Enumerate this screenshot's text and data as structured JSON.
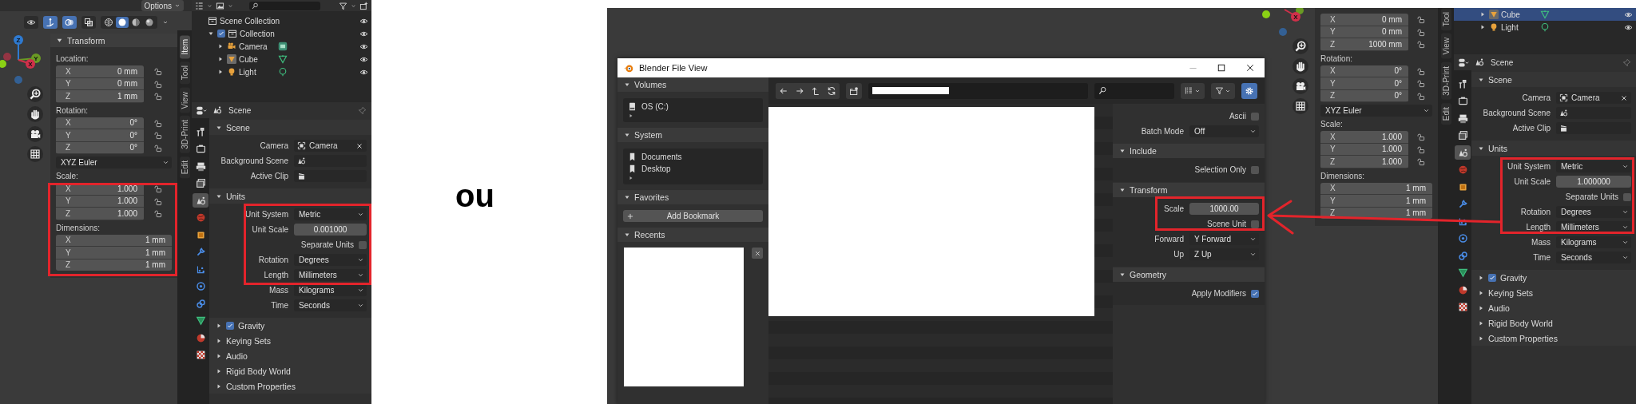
{
  "left_shot": {
    "viewport": {
      "options_label": "Options",
      "toggles": [
        {
          "kind": "visibility",
          "on": false
        },
        {
          "kind": "gizmo",
          "on": true
        },
        {
          "kind": "overlay",
          "on": true
        },
        {
          "kind": "xray",
          "on": false
        }
      ],
      "shading_modes": [
        {
          "kind": "wireframe",
          "selected": false
        },
        {
          "kind": "solid",
          "selected": true
        },
        {
          "kind": "material",
          "selected": false
        },
        {
          "kind": "rendered",
          "selected": false
        }
      ],
      "gizmo_labels": [
        "Z",
        "Y",
        "X"
      ]
    },
    "n_panel": {
      "title": "Transform",
      "groups": [
        {
          "label": "Location:",
          "kind": "lockable",
          "rows": [
            {
              "axis": "X",
              "value": "0 mm"
            },
            {
              "axis": "Y",
              "value": "0 mm"
            },
            {
              "axis": "Z",
              "value": "1 mm"
            }
          ]
        },
        {
          "label": "Rotation:",
          "kind": "lockable",
          "rows": [
            {
              "axis": "X",
              "value": "0°"
            },
            {
              "axis": "Y",
              "value": "0°"
            },
            {
              "axis": "Z",
              "value": "0°"
            }
          ]
        },
        {
          "kind": "mode",
          "value": "XYZ Euler"
        },
        {
          "label": "Scale:",
          "kind": "lockable",
          "rows": [
            {
              "axis": "X",
              "value": "1.000"
            },
            {
              "axis": "Y",
              "value": "1.000"
            },
            {
              "axis": "Z",
              "value": "1.000"
            }
          ]
        },
        {
          "label": "Dimensions:",
          "kind": "plain",
          "rows": [
            {
              "axis": "X",
              "value": "1 mm"
            },
            {
              "axis": "Y",
              "value": "1 mm"
            },
            {
              "axis": "Z",
              "value": "1 mm"
            }
          ]
        }
      ]
    },
    "n_tabs": [
      {
        "label": "Item",
        "selected": true
      },
      {
        "label": "Tool",
        "selected": false
      },
      {
        "label": "View",
        "selected": false
      },
      {
        "label": "3D-Print",
        "selected": false
      },
      {
        "label": "Edit",
        "selected": false
      }
    ],
    "outliner": {
      "items": [
        {
          "label": "Scene Collection",
          "kind": "collection",
          "selected": false,
          "children": [
            {
              "label": "Collection",
              "kind": "collection",
              "checked": true,
              "expanded": true,
              "selected": false,
              "children": [
                {
                  "label": "Camera",
                  "kind": "camera",
                  "expanded": false,
                  "selected": false
                },
                {
                  "label": "Cube",
                  "kind": "mesh",
                  "expanded": false,
                  "selected": false
                },
                {
                  "label": "Light",
                  "kind": "light",
                  "expanded": false,
                  "selected": false
                }
              ]
            }
          ]
        }
      ]
    },
    "properties": {
      "context": "Scene",
      "tabs": [
        {
          "kind": "tool",
          "selected": false
        },
        {
          "kind": "render",
          "selected": false
        },
        {
          "kind": "output",
          "selected": false
        },
        {
          "kind": "view_layer",
          "selected": false
        },
        {
          "kind": "scene",
          "selected": true
        },
        {
          "kind": "world",
          "selected": false
        },
        {
          "kind": "object",
          "selected": false
        },
        {
          "kind": "modifier",
          "selected": false
        },
        {
          "kind": "particles",
          "selected": false
        },
        {
          "kind": "physics",
          "selected": false
        },
        {
          "kind": "constraint",
          "selected": false
        },
        {
          "kind": "data",
          "selected": false
        },
        {
          "kind": "material",
          "selected": false
        },
        {
          "kind": "texture",
          "selected": false
        }
      ],
      "sections": [
        {
          "title": "Scene",
          "expanded": true,
          "rows": [
            {
              "kind": "object",
              "label": "Camera",
              "value": "Camera"
            },
            {
              "kind": "object",
              "label": "Background Scene"
            },
            {
              "kind": "object",
              "label": "Active Clip"
            }
          ]
        },
        {
          "title": "Units",
          "expanded": true,
          "rows": [
            {
              "kind": "dropdown",
              "label": "Unit System",
              "value": "Metric"
            },
            {
              "kind": "number",
              "label": "Unit Scale",
              "value": "0.001000"
            },
            {
              "kind": "checkbox",
              "label": "Separate Units",
              "checked": false
            },
            {
              "kind": "dropdown",
              "label": "Rotation",
              "value": "Degrees"
            },
            {
              "kind": "dropdown",
              "label": "Length",
              "value": "Millimeters"
            },
            {
              "kind": "dropdown",
              "label": "Mass",
              "value": "Kilograms"
            },
            {
              "kind": "dropdown",
              "label": "Time",
              "value": "Seconds"
            }
          ]
        },
        {
          "title": "Gravity",
          "expanded": false,
          "checked": true
        },
        {
          "title": "Keying Sets",
          "expanded": false
        },
        {
          "title": "Audio",
          "expanded": false
        },
        {
          "title": "Rigid Body World",
          "expanded": false
        },
        {
          "title": "Custom Properties",
          "expanded": false
        }
      ]
    }
  },
  "divider_text": "ou",
  "right_shot": {
    "viewport": {
      "gizmo_labels": [
        "X"
      ]
    },
    "n_panel": {
      "groups": [
        {
          "kind": "lockable",
          "rows": [
            {
              "axis": "X",
              "value": "0 mm"
            },
            {
              "axis": "Y",
              "value": "0 mm"
            },
            {
              "axis": "Z",
              "value": "1000 mm"
            }
          ]
        },
        {
          "label": "Rotation:",
          "kind": "lockable",
          "rows": [
            {
              "axis": "X",
              "value": "0°"
            },
            {
              "axis": "Y",
              "value": "0°"
            },
            {
              "axis": "Z",
              "value": "0°"
            }
          ]
        },
        {
          "kind": "mode",
          "value": "XYZ Euler"
        },
        {
          "label": "Scale:",
          "kind": "lockable",
          "rows": [
            {
              "axis": "X",
              "value": "1.000"
            },
            {
              "axis": "Y",
              "value": "1.000"
            },
            {
              "axis": "Z",
              "value": "1.000"
            }
          ]
        },
        {
          "label": "Dimensions:",
          "kind": "plain",
          "rows": [
            {
              "axis": "X",
              "value": "1 mm"
            },
            {
              "axis": "Y",
              "value": "1 mm"
            },
            {
              "axis": "Z",
              "value": "1 mm"
            }
          ]
        }
      ]
    },
    "n_tabs": [
      {
        "label": "Tool",
        "selected": false
      },
      {
        "label": "View",
        "selected": false
      },
      {
        "label": "3D-Print",
        "selected": false
      },
      {
        "label": "Edit",
        "selected": false
      }
    ],
    "file_browser": {
      "title": "Blender File View",
      "options_toggle": {
        "on": true
      },
      "sidebar": [
        {
          "title": "Volumes",
          "expanded": true,
          "kind": "list",
          "items": [
            {
              "label": "OS (C:)",
              "kind": "drive"
            }
          ]
        },
        {
          "title": "System",
          "expanded": true,
          "kind": "list",
          "items": [
            {
              "label": "Documents",
              "kind": "bookmark"
            },
            {
              "label": "Desktop",
              "kind": "bookmark"
            }
          ]
        },
        {
          "title": "Favorites",
          "expanded": true,
          "kind": "button",
          "button": "Add Bookmark"
        },
        {
          "title": "Recents",
          "expanded": true,
          "kind": "recent"
        }
      ],
      "options": {
        "rows": [
          {
            "kind": "checkbox",
            "label": "Ascii",
            "checked": false
          },
          {
            "kind": "dropdown",
            "label": "Batch Mode",
            "value": "Off"
          }
        ],
        "sections": [
          {
            "title": "Include",
            "expanded": true,
            "rows": [
              {
                "kind": "checkbox",
                "label": "Selection Only",
                "checked": false
              }
            ]
          },
          {
            "title": "Transform",
            "expanded": true,
            "rows": [
              {
                "kind": "number",
                "label": "Scale",
                "value": "1000.00"
              },
              {
                "kind": "checkbox",
                "label": "Scene Unit",
                "checked": false
              },
              {
                "kind": "dropdown",
                "label": "Forward",
                "value": "Y Forward"
              },
              {
                "kind": "dropdown",
                "label": "Up",
                "value": "Z Up"
              }
            ]
          },
          {
            "title": "Geometry",
            "expanded": true,
            "rows": [
              {
                "kind": "checkbox",
                "label": "Apply Modifiers",
                "checked": true
              }
            ]
          }
        ]
      }
    },
    "outliner": {
      "items": [
        {
          "label": "Cube",
          "kind": "mesh",
          "expanded": false,
          "selected": true
        },
        {
          "label": "Light",
          "kind": "light",
          "expanded": false,
          "selected": false
        }
      ]
    },
    "properties": {
      "context": "Scene",
      "tabs": [
        {
          "kind": "tool",
          "selected": false
        },
        {
          "kind": "render",
          "selected": false
        },
        {
          "kind": "output",
          "selected": false
        },
        {
          "kind": "view_layer",
          "selected": false
        },
        {
          "kind": "scene",
          "selected": true
        },
        {
          "kind": "world",
          "selected": false
        },
        {
          "kind": "object",
          "selected": false
        },
        {
          "kind": "modifier",
          "selected": false
        },
        {
          "kind": "particles",
          "selected": false
        },
        {
          "kind": "physics",
          "selected": false
        },
        {
          "kind": "constraint",
          "selected": false
        },
        {
          "kind": "data",
          "selected": false
        },
        {
          "kind": "material",
          "selected": false
        },
        {
          "kind": "texture",
          "selected": false
        }
      ],
      "sections": [
        {
          "title": "Scene",
          "expanded": true,
          "rows": [
            {
              "kind": "object",
              "label": "Camera",
              "value": "Camera"
            },
            {
              "kind": "object",
              "label": "Background Scene"
            },
            {
              "kind": "object",
              "label": "Active Clip"
            }
          ]
        },
        {
          "title": "Units",
          "expanded": true,
          "rows": [
            {
              "kind": "dropdown",
              "label": "Unit System",
              "value": "Metric"
            },
            {
              "kind": "number",
              "label": "Unit Scale",
              "value": "1.000000"
            },
            {
              "kind": "checkbox",
              "label": "Separate Units",
              "checked": false
            },
            {
              "kind": "dropdown",
              "label": "Rotation",
              "value": "Degrees"
            },
            {
              "kind": "dropdown",
              "label": "Length",
              "value": "Millimeters"
            },
            {
              "kind": "dropdown",
              "label": "Mass",
              "value": "Kilograms"
            },
            {
              "kind": "dropdown",
              "label": "Time",
              "value": "Seconds"
            }
          ]
        },
        {
          "title": "Gravity",
          "expanded": false,
          "checked": true
        },
        {
          "title": "Keying Sets",
          "expanded": false
        },
        {
          "title": "Audio",
          "expanded": false
        },
        {
          "title": "Rigid Body World",
          "expanded": false
        },
        {
          "title": "Custom Properties",
          "expanded": false
        }
      ]
    }
  }
}
